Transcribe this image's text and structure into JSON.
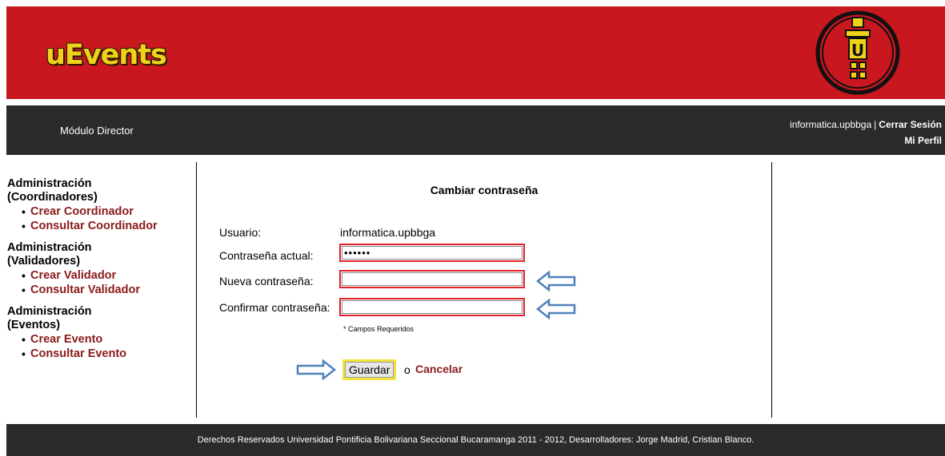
{
  "header": {
    "logo_text": "uEvents",
    "emblem_letter": "U",
    "brand_color": "#c8171f",
    "logo_color": "#f0d21c"
  },
  "navbar": {
    "module_title": "Módulo Director",
    "username": "informatica.upbbga",
    "separator": "|",
    "logout_label": "Cerrar Sesión",
    "profile_label": "Mi Perfil"
  },
  "sidebar": {
    "sections": [
      {
        "title": "Administración (Coordinadores)",
        "items": [
          "Crear Coordinador",
          "Consultar Coordinador"
        ]
      },
      {
        "title": "Administración (Validadores)",
        "items": [
          "Crear Validador",
          "Consultar Validador"
        ]
      },
      {
        "title": "Administración (Eventos)",
        "items": [
          "Crear Evento",
          "Consultar Evento"
        ]
      }
    ],
    "bullet": "•"
  },
  "form": {
    "title": "Cambiar contraseña",
    "user_label": "Usuario:",
    "user_value": "informatica.upbbga",
    "current_label": "Contraseña actual:",
    "current_value": "••••••",
    "new_label": "Nueva contraseña:",
    "confirm_label": "Confirmar contraseña:",
    "required_note": "* Campos Requeridos",
    "save_label": "Guardar",
    "or_text": "o",
    "cancel_label": "Cancelar"
  },
  "footer": {
    "text": "Derechos Reservados Universidad Pontificia Bolivariana Seccional Bucaramanga 2011 - 2012, Desarrolladores: Jorge Madrid, Cristian Blanco."
  },
  "colors": {
    "dark_bar": "#2b2b2b",
    "link_red": "#8b1a1a",
    "highlight_red": "#e0232a",
    "highlight_yellow": "#f2e23a",
    "arrow_blue": "#4f81bd"
  },
  "icons": {
    "annotation_arrow": "arrow-left-outline-icon",
    "annotation_arrow_save": "arrow-right-outline-icon"
  }
}
